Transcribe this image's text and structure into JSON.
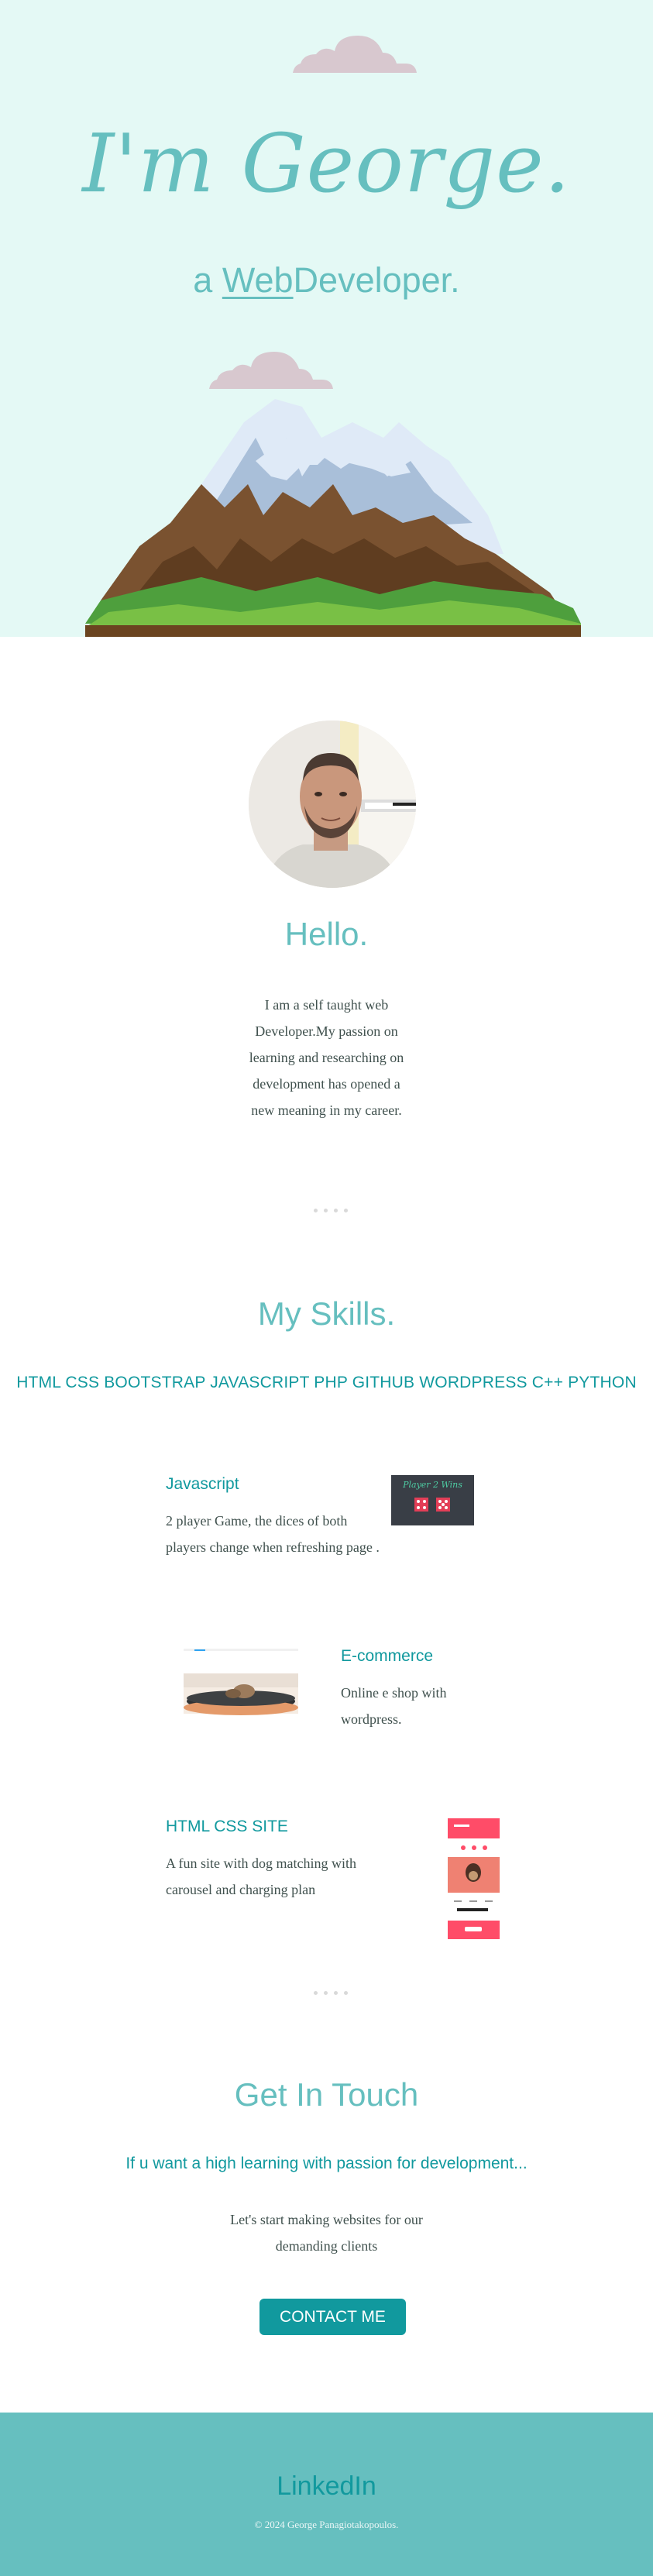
{
  "hero": {
    "title": "I'm George.",
    "subtitle_prefix": "a ",
    "subtitle_link": "Web",
    "subtitle_suffix": "Developer."
  },
  "about": {
    "heading": "Hello.",
    "lines": [
      "I am a self taught web",
      "Developer.My passion on",
      "learning and researching on",
      "development has opened a",
      "new meaning in my career."
    ]
  },
  "skills": {
    "heading": "My Skills.",
    "list": "HTML CSS BOOTSTRAP JAVASCRIPT PHP GITHUB WORDPRESS C++ PYTHON"
  },
  "projects": [
    {
      "title": "Javascript",
      "lines": [
        "2 player Game, the dices of both",
        "players change when refreshing page ."
      ],
      "thumb_text": "Player 2 Wins"
    },
    {
      "title": "E-commerce",
      "lines": [
        "Online e shop with",
        "wordpress."
      ]
    },
    {
      "title": "HTML CSS SITE",
      "lines": [
        "A fun site with dog matching with",
        "carousel and charging plan"
      ]
    }
  ],
  "contact": {
    "heading": "Get In Touch",
    "subheading": "If u want a high learning with passion for development...",
    "lines": [
      "Let's start making websites for our",
      "demanding clients"
    ],
    "button": "CONTACT ME"
  },
  "footer": {
    "link": "LinkedIn",
    "copyright": "© 2024 George Panagiotakopoulos."
  },
  "colors": {
    "hero_bg": "#e4f9f5",
    "accent": "#66bfbf",
    "accent_dark": "#11999e",
    "text": "#40514e"
  }
}
